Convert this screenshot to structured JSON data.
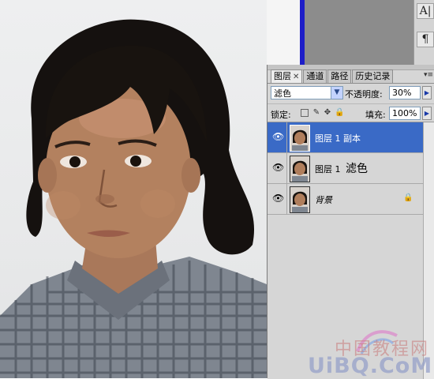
{
  "toolbar": {
    "text_tool_label": "A|",
    "para_tool_label": "¶"
  },
  "layers_panel": {
    "tabs": [
      {
        "label": "图层",
        "active": true,
        "close": "✕"
      },
      {
        "label": "通道",
        "active": false
      },
      {
        "label": "路径",
        "active": false
      },
      {
        "label": "历史记录",
        "active": false
      }
    ],
    "menu_glyph": "▾≡",
    "blend_mode": "滤色",
    "opacity_label": "不透明度:",
    "opacity_value": "30%",
    "lock_label": "锁定:",
    "fill_label": "填充:",
    "fill_value": "100%",
    "layers": [
      {
        "name": "图层 1 副本",
        "mode_label": "",
        "selected": true,
        "locked": false
      },
      {
        "name": "图层 1",
        "mode_label": "滤色",
        "selected": false,
        "locked": false
      },
      {
        "name": "背景",
        "mode_label": "",
        "selected": false,
        "locked": true
      }
    ]
  },
  "watermark": {
    "cn": "中国教程网",
    "latin": "UiBQ.CoM"
  },
  "icons": {
    "eye": "eye-icon",
    "lock": "lock-icon",
    "dropdown": "chevron-down-icon",
    "arrow": "chevron-right-icon"
  },
  "colors": {
    "selection": "#3a6ac6",
    "accent_blue": "#1d1dc8"
  }
}
